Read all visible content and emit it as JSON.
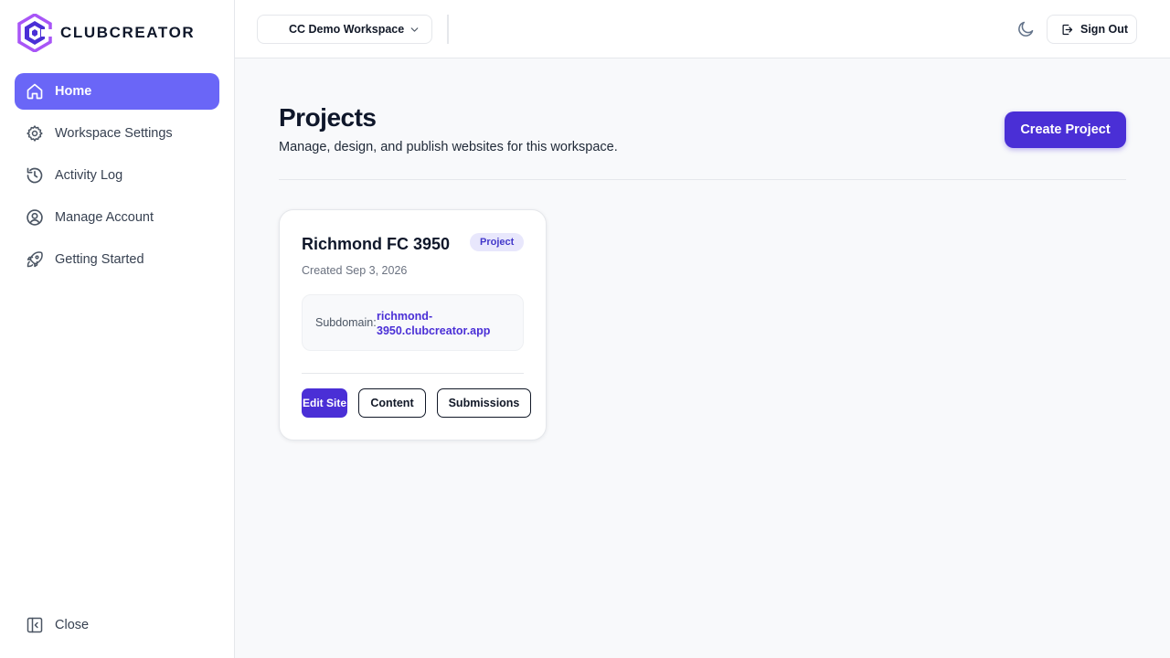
{
  "brand": {
    "name": "CLUBCREATOR",
    "accent": "#6a66f7",
    "primary": "#4a2fd6"
  },
  "sidebar": {
    "items": [
      {
        "label": "Home",
        "icon": "home-icon",
        "active": true
      },
      {
        "label": "Workspace Settings",
        "icon": "gear-icon",
        "active": false
      },
      {
        "label": "Activity Log",
        "icon": "history-icon",
        "active": false
      },
      {
        "label": "Manage Account",
        "icon": "user-circle-icon",
        "active": false
      },
      {
        "label": "Getting Started",
        "icon": "rocket-icon",
        "active": false
      }
    ],
    "close_label": "Close"
  },
  "header": {
    "workspace": "CC Demo Workspace",
    "sign_out_label": "Sign Out"
  },
  "main": {
    "title": "Projects",
    "subtitle": "Manage, design, and publish websites for this workspace.",
    "create_label": "Create Project"
  },
  "project": {
    "name": "Richmond FC 3950",
    "badge": "Project",
    "created": "Created Sep 3, 2026",
    "subdomain_label": "Subdomain:",
    "subdomain_value": "richmond-3950.clubcreator.app",
    "edit_label": "Edit Site",
    "content_label": "Content",
    "submissions_label": "Submissions"
  }
}
